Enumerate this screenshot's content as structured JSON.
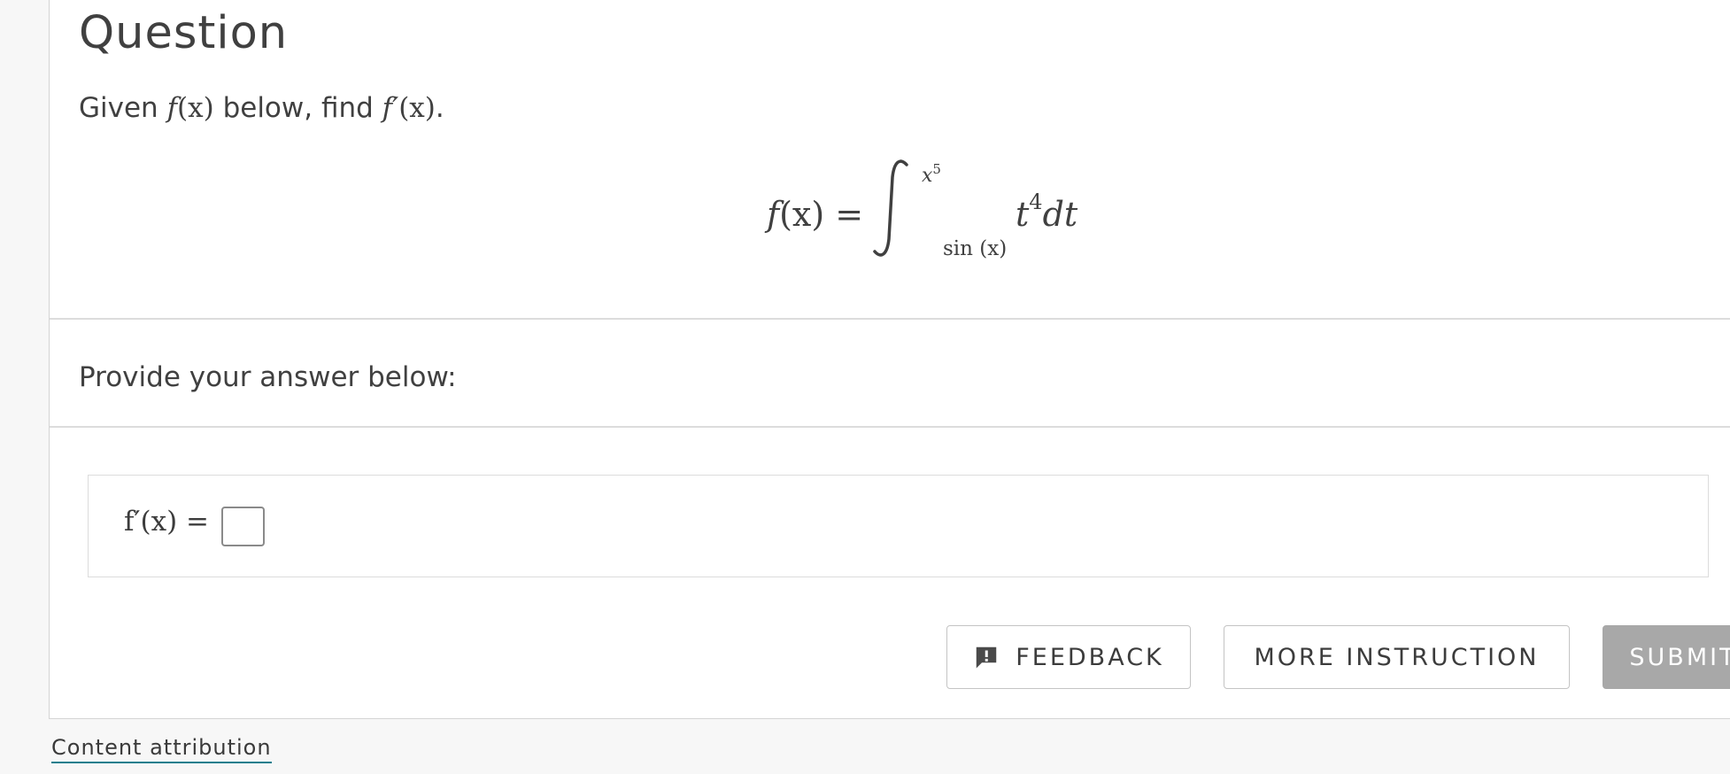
{
  "question": {
    "heading": "Question",
    "prompt_prefix": "Given ",
    "prompt_f": "f",
    "prompt_fx_arg": "(x)",
    "prompt_middle": " below, find ",
    "prompt_fprime": "f′",
    "prompt_fprime_arg": "(x)",
    "prompt_suffix": ".",
    "formula": {
      "lhs_f": "f",
      "lhs_arg": "(x) =",
      "upper_base": "x",
      "upper_exp": "5",
      "lower_limit": "sin (x)",
      "integrand_base": "t",
      "integrand_exp": "4",
      "differential": "dt"
    }
  },
  "answer": {
    "prompt": "Provide your answer below:",
    "label": "f′(x) =",
    "input_value": ""
  },
  "actions": {
    "feedback_label": "FEEDBACK",
    "more_instruction_label": "MORE INSTRUCTION",
    "submit_label": "SUBMIT",
    "feedback_icon": "feedback-icon"
  },
  "footer": {
    "attribution_label": "Content attribution"
  },
  "colors": {
    "submit_bg": "#a8a8a8",
    "link_underline": "#1a7f8e",
    "page_bg": "#f7f7f7"
  }
}
